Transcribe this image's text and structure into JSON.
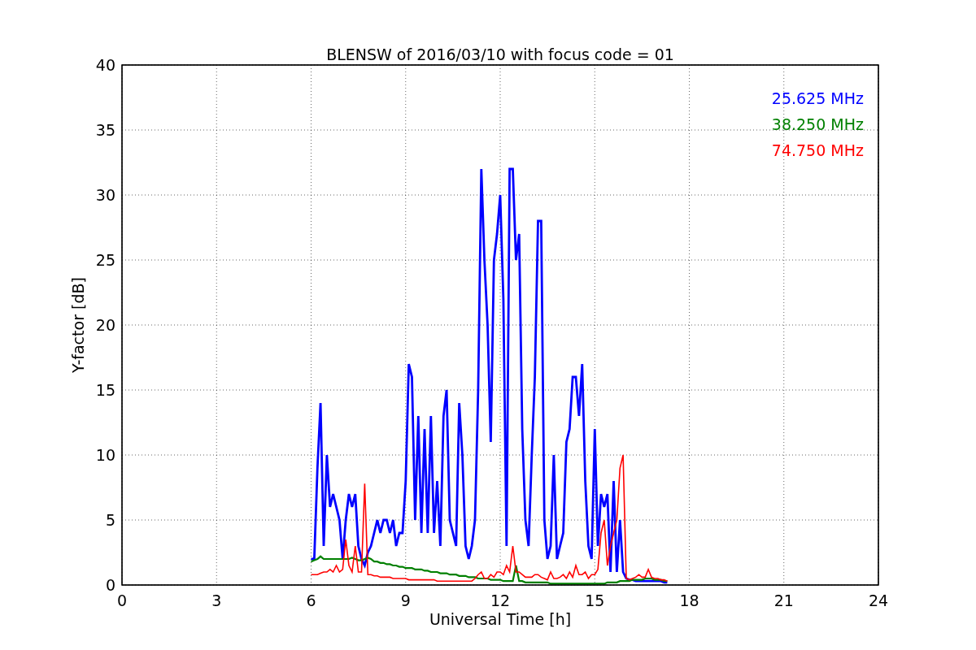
{
  "plot": {
    "chart_data": {
      "type": "line",
      "title": "BLENSW of 2016/03/10 with focus code = 01",
      "xlabel": "Universal Time [h]",
      "ylabel": "Y-factor [dB]",
      "xlim": [
        0,
        24
      ],
      "ylim": [
        0,
        40
      ],
      "xticks": [
        0,
        3,
        6,
        9,
        12,
        15,
        18,
        21,
        24
      ],
      "yticks": [
        0,
        5,
        10,
        15,
        20,
        25,
        30,
        35,
        40
      ],
      "grid": true,
      "x": [
        6.0,
        6.1,
        6.2,
        6.3,
        6.4,
        6.5,
        6.6,
        6.7,
        6.8,
        6.9,
        7.0,
        7.1,
        7.2,
        7.3,
        7.4,
        7.5,
        7.6,
        7.7,
        7.8,
        7.9,
        8.0,
        8.1,
        8.2,
        8.3,
        8.4,
        8.5,
        8.6,
        8.7,
        8.8,
        8.9,
        9.0,
        9.1,
        9.2,
        9.3,
        9.4,
        9.5,
        9.6,
        9.7,
        9.8,
        9.9,
        10.0,
        10.1,
        10.2,
        10.3,
        10.4,
        10.5,
        10.6,
        10.7,
        10.8,
        10.9,
        11.0,
        11.1,
        11.2,
        11.3,
        11.4,
        11.5,
        11.6,
        11.7,
        11.8,
        11.9,
        12.0,
        12.1,
        12.2,
        12.3,
        12.4,
        12.5,
        12.6,
        12.7,
        12.8,
        12.9,
        13.0,
        13.1,
        13.2,
        13.3,
        13.4,
        13.5,
        13.6,
        13.7,
        13.8,
        13.9,
        14.0,
        14.1,
        14.2,
        14.3,
        14.4,
        14.5,
        14.6,
        14.7,
        14.8,
        14.9,
        15.0,
        15.1,
        15.2,
        15.3,
        15.4,
        15.5,
        15.6,
        15.7,
        15.8,
        15.9,
        16.0,
        16.1,
        16.2,
        16.3,
        16.4,
        16.5,
        16.6,
        16.7,
        16.8,
        16.9,
        17.0,
        17.1,
        17.2,
        17.3
      ],
      "series": [
        {
          "name": "25.625 MHz",
          "color": "#0000ff",
          "values": [
            2,
            2,
            9,
            14,
            3,
            10,
            6,
            7,
            6,
            5,
            2,
            5,
            7,
            6,
            7,
            3,
            2,
            1.5,
            2.5,
            3,
            4,
            5,
            4,
            5,
            5,
            4,
            5,
            3,
            4,
            4,
            8,
            17,
            16,
            5,
            13,
            4,
            12,
            4,
            13,
            4,
            8,
            3,
            13,
            15,
            5,
            4,
            3,
            14,
            10,
            3,
            2,
            3,
            5,
            15,
            32,
            25,
            20,
            11,
            25,
            27,
            30,
            22,
            3,
            32,
            32,
            25,
            27,
            12,
            5,
            3,
            10,
            16,
            28,
            28,
            5,
            2,
            3,
            10,
            2,
            3,
            4,
            11,
            12,
            16,
            16,
            13,
            17,
            8,
            3,
            2,
            12,
            3,
            7,
            6,
            7,
            1,
            8,
            1,
            5,
            1,
            0.5,
            0.4,
            0.4,
            0.3,
            0.3,
            0.3,
            0.3,
            0.3,
            0.3,
            0.3,
            0.3,
            0.3,
            0.2,
            0.2
          ]
        },
        {
          "name": "38.250 MHz",
          "color": "#008000",
          "values": [
            1.8,
            1.9,
            2,
            2.2,
            2,
            2,
            2,
            2,
            2,
            2,
            2,
            2,
            2,
            2.1,
            2,
            1.9,
            1.9,
            2,
            2.1,
            2,
            1.8,
            1.8,
            1.7,
            1.7,
            1.6,
            1.6,
            1.5,
            1.5,
            1.4,
            1.4,
            1.3,
            1.3,
            1.3,
            1.2,
            1.2,
            1.2,
            1.1,
            1.1,
            1,
            1,
            1,
            0.9,
            0.9,
            0.9,
            0.8,
            0.8,
            0.8,
            0.7,
            0.7,
            0.7,
            0.6,
            0.6,
            0.6,
            0.5,
            0.5,
            0.5,
            0.5,
            0.4,
            0.4,
            0.4,
            0.4,
            0.3,
            0.3,
            0.3,
            0.3,
            1.5,
            0.3,
            0.3,
            0.2,
            0.2,
            0.2,
            0.2,
            0.2,
            0.2,
            0.2,
            0.2,
            0.1,
            0.1,
            0.1,
            0.1,
            0.1,
            0.1,
            0.1,
            0.1,
            0.1,
            0.1,
            0.1,
            0.1,
            0.1,
            0.1,
            0.1,
            0.1,
            0.1,
            0.1,
            0.2,
            0.2,
            0.2,
            0.2,
            0.3,
            0.3,
            0.3,
            0.3,
            0.4,
            0.4,
            0.4,
            0.4,
            0.5,
            0.5,
            0.5,
            0.4,
            0.4,
            0.4,
            0.3,
            0.3
          ]
        },
        {
          "name": "74.750 MHz",
          "color": "#ff0000",
          "values": [
            0.8,
            0.8,
            0.8,
            0.9,
            1,
            1,
            1.2,
            1,
            1.5,
            1,
            1.2,
            3.5,
            1.5,
            1,
            3,
            1,
            1,
            7.8,
            0.8,
            0.8,
            0.7,
            0.7,
            0.6,
            0.6,
            0.6,
            0.6,
            0.5,
            0.5,
            0.5,
            0.5,
            0.5,
            0.4,
            0.4,
            0.4,
            0.4,
            0.4,
            0.4,
            0.4,
            0.4,
            0.4,
            0.3,
            0.3,
            0.3,
            0.3,
            0.3,
            0.3,
            0.3,
            0.3,
            0.3,
            0.3,
            0.3,
            0.3,
            0.5,
            0.8,
            1,
            0.5,
            0.5,
            0.8,
            0.6,
            1,
            1,
            0.8,
            1.5,
            1,
            3,
            1,
            1,
            0.8,
            0.6,
            0.6,
            0.6,
            0.8,
            0.8,
            0.6,
            0.5,
            0.4,
            1,
            0.5,
            0.5,
            0.6,
            0.8,
            0.5,
            1,
            0.6,
            1.5,
            0.8,
            0.8,
            1,
            0.5,
            0.8,
            0.8,
            1.2,
            4,
            5,
            1.5,
            3,
            4,
            5,
            9,
            10,
            0.5,
            0.4,
            0.5,
            0.6,
            0.8,
            0.6,
            0.6,
            1.2,
            0.6,
            0.5,
            0.5,
            0.4,
            0.4,
            0.3
          ]
        }
      ]
    }
  }
}
